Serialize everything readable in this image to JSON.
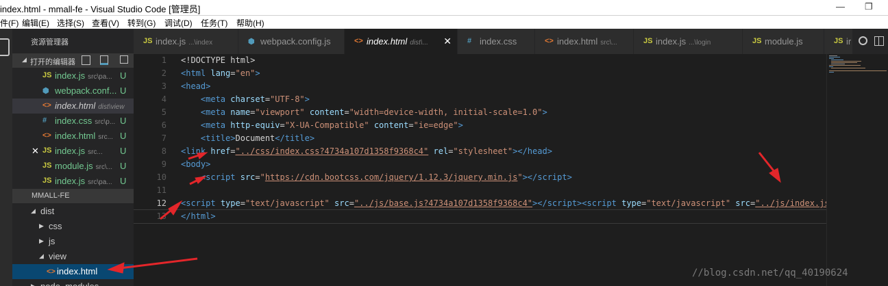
{
  "window": {
    "title": "index.html - mmall-fe - Visual Studio Code [管理员]"
  },
  "menu": [
    "件(F)",
    "编辑(E)",
    "选择(S)",
    "查看(V)",
    "转到(G)",
    "调试(D)",
    "任务(T)",
    "帮助(H)"
  ],
  "sidebar": {
    "title": "资源管理器",
    "open_editors_label": "打开的编辑器",
    "open_editors": [
      {
        "icon": "JS",
        "name": "index.js",
        "path": "src\\pa...",
        "status": "U"
      },
      {
        "icon": "⬢",
        "name": "webpack.conf...",
        "path": "",
        "status": "U"
      },
      {
        "icon": "<>",
        "name": "index.html",
        "path": "dist\\view",
        "status": ""
      },
      {
        "icon": "#",
        "name": "index.css",
        "path": "src\\p...",
        "status": "U"
      },
      {
        "icon": "<>",
        "name": "index.html",
        "path": "src...",
        "status": "U"
      },
      {
        "icon": "JS",
        "name": "index.js",
        "path": "src...",
        "status": "U"
      },
      {
        "icon": "JS",
        "name": "module.js",
        "path": "src\\...",
        "status": "U"
      },
      {
        "icon": "JS",
        "name": "index.js",
        "path": "src\\pa...",
        "status": "U"
      }
    ],
    "project_label": "MMALL-FE",
    "tree": [
      {
        "name": "dist",
        "arrow": "◢"
      },
      {
        "name": "css",
        "arrow": "▶"
      },
      {
        "name": "js",
        "arrow": "▶"
      },
      {
        "name": "view",
        "arrow": "◢"
      },
      {
        "name": "index.html",
        "arrow": ""
      },
      {
        "name": "node_modules",
        "arrow": "▶"
      }
    ]
  },
  "tabs": [
    {
      "icon": "JS",
      "name": "index.js",
      "path": "...\\index"
    },
    {
      "icon": "⬢",
      "name": "webpack.config.js",
      "path": ""
    },
    {
      "icon": "<>",
      "name": "index.html",
      "path": "dist\\...",
      "close": "✕"
    },
    {
      "icon": "#",
      "name": "index.css",
      "path": ""
    },
    {
      "icon": "<>",
      "name": "index.html",
      "path": "src\\..."
    },
    {
      "icon": "JS",
      "name": "index.js",
      "path": "...\\login"
    },
    {
      "icon": "JS",
      "name": "module.js",
      "path": ""
    },
    {
      "icon": "JS",
      "name": "ir",
      "path": ""
    }
  ],
  "editor": {
    "line_numbers": [
      "1",
      "2",
      "3",
      "4",
      "5",
      "6",
      "7",
      "8",
      "9",
      "10",
      "11",
      "12",
      "13"
    ]
  },
  "watermark": "//blog.csdn.net/qq_40190624",
  "colors": {
    "accent": "#094771",
    "js_icon": "#cbcb41",
    "html_icon": "#e37933",
    "css_icon": "#519aba",
    "arrow_red": "#e3262a"
  }
}
